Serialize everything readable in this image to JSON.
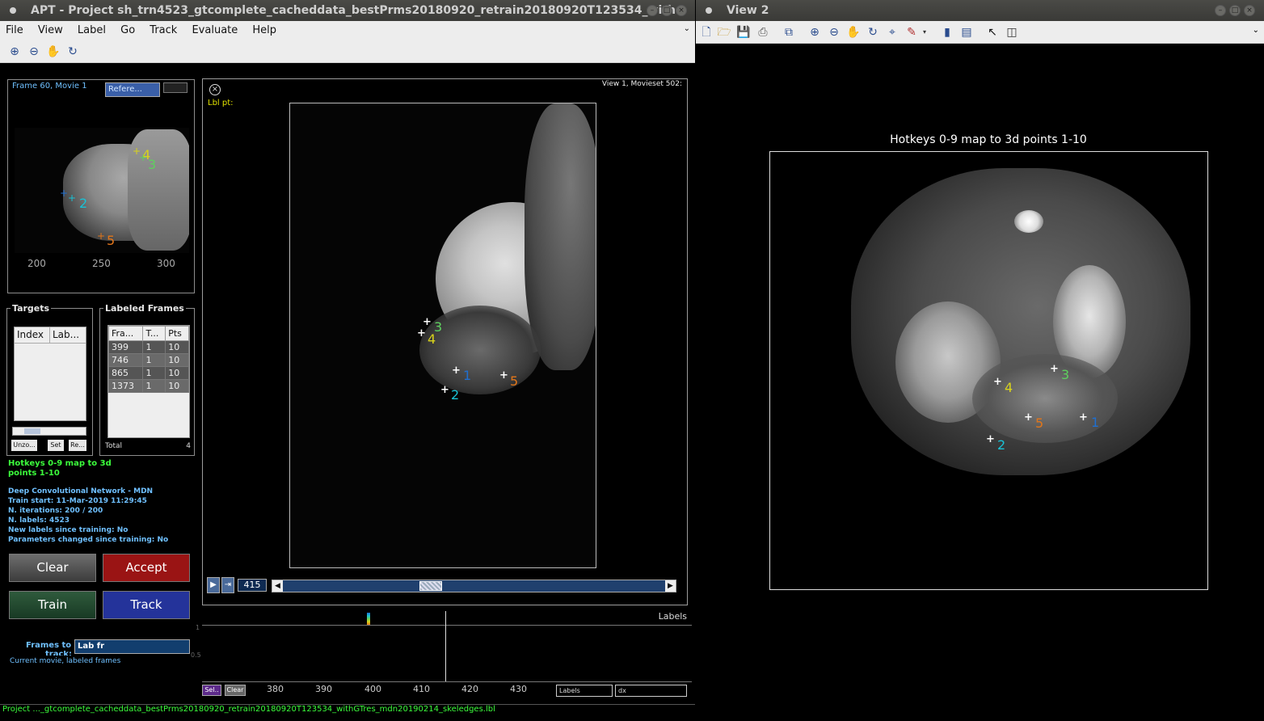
{
  "left_window": {
    "title": "APT - Project sh_trn4523_gtcomplete_cacheddata_bestPrms20180920_retrain20180920T123534_with",
    "menu": [
      "File",
      "View",
      "Label",
      "Go",
      "Track",
      "Evaluate",
      "Help"
    ],
    "overview": {
      "frame_label": "Frame 60, Movie 1",
      "reference_dropdown": "Refere...",
      "x_ticks": [
        "200",
        "250",
        "300"
      ]
    },
    "targets": {
      "title": "Targets",
      "columns": [
        "Index",
        "Lab..."
      ],
      "buttons": [
        "Unzo...",
        "Set",
        "Re..."
      ]
    },
    "labeled_frames": {
      "title": "Labeled Frames",
      "columns": [
        "Fra...",
        "T...",
        "Pts"
      ],
      "rows": [
        [
          "399",
          "1",
          "10"
        ],
        [
          "746",
          "1",
          "10"
        ],
        [
          "865",
          "1",
          "10"
        ],
        [
          "1373",
          "1",
          "10"
        ]
      ],
      "total_label": "Total",
      "total_value": "4"
    },
    "hotkeys_text_1": "Hotkeys 0-9 map to 3d",
    "hotkeys_text_2": "points 1-10",
    "tracker_info": [
      "Deep Convolutional Network - MDN",
      "Train start: 11-Mar-2019 11:29:45",
      "N. iterations: 200 / 200",
      "N. labels: 4523",
      "New labels since training: No",
      "Parameters changed since training: No"
    ],
    "buttons": {
      "clear": "Clear",
      "accept": "Accept",
      "train": "Train",
      "track": "Track"
    },
    "frames_to_track_label_1": "Frames to",
    "frames_to_track_label_2": "track:",
    "frames_to_track_value": "Lab fr",
    "frames_to_track_desc": "Current movie, labeled frames",
    "main_view": {
      "header_right": "View 1, Movieset 502:",
      "lbl_pt": "Lbl pt:",
      "frame_number": "415",
      "slider_fraction": 0.38
    },
    "timeline": {
      "labels_title": "Labels",
      "x_ticks": [
        "380",
        "390",
        "400",
        "410",
        "420",
        "430"
      ],
      "y_ticks": [
        "1",
        "0.5"
      ],
      "sel_button": "Sel..",
      "clear_button": "Clear",
      "labels_dropdown": "Labels",
      "dx_dropdown": "dx"
    },
    "status_bar": "Project ..._gtcomplete_cacheddata_bestPrms20180920_retrain20180920T123534_withGTres_mdn20190214_skeledges.lbl",
    "landmarks": [
      {
        "id": "1",
        "color": "#1f6fd0"
      },
      {
        "id": "2",
        "color": "#19c2d6"
      },
      {
        "id": "3",
        "color": "#5fd05f"
      },
      {
        "id": "4",
        "color": "#d8d21c"
      },
      {
        "id": "5",
        "color": "#e2761a"
      }
    ]
  },
  "right_window": {
    "title": "View 2",
    "plot_title": "Hotkeys 0-9 map to 3d points 1-10"
  }
}
